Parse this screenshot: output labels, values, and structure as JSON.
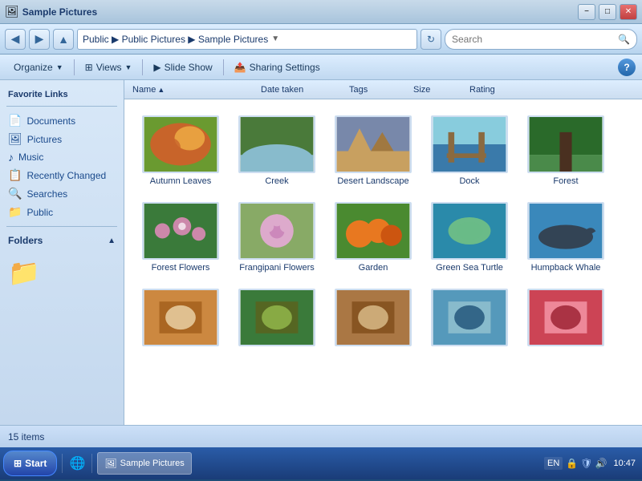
{
  "titlebar": {
    "title": "Sample Pictures",
    "min_btn": "−",
    "max_btn": "□",
    "close_btn": "✕"
  },
  "navbar": {
    "back_icon": "◀",
    "forward_icon": "▶",
    "up_icon": "▲",
    "address": "Public ▶ Public Pictures ▶ Sample Pictures",
    "refresh_icon": "↻",
    "search_placeholder": "Search"
  },
  "toolbar": {
    "organize_label": "Organize",
    "views_label": "Views",
    "slideshow_label": "Slide Show",
    "sharing_label": "Sharing Settings",
    "help_icon": "?"
  },
  "sidebar": {
    "section_title": "Favorite Links",
    "items": [
      {
        "id": "documents",
        "label": "Documents",
        "icon": "📄"
      },
      {
        "id": "pictures",
        "label": "Pictures",
        "icon": "🖼"
      },
      {
        "id": "music",
        "label": "Music",
        "icon": "♪"
      },
      {
        "id": "recently-changed",
        "label": "Recently Changed",
        "icon": "📋"
      },
      {
        "id": "searches",
        "label": "Searches",
        "icon": "🔍"
      },
      {
        "id": "public",
        "label": "Public",
        "icon": "📁"
      }
    ],
    "folders_label": "Folders",
    "folders_arrow": "▲"
  },
  "columns": [
    {
      "id": "name",
      "label": "Name",
      "sort": "▲"
    },
    {
      "id": "date-taken",
      "label": "Date taken"
    },
    {
      "id": "tags",
      "label": "Tags"
    },
    {
      "id": "size",
      "label": "Size"
    },
    {
      "id": "rating",
      "label": "Rating"
    }
  ],
  "files": [
    {
      "id": "autumn-leaves",
      "name": "Autumn Leaves",
      "color1": "#c8642a",
      "color2": "#e8a040",
      "color3": "#6a9a30"
    },
    {
      "id": "creek",
      "name": "Creek",
      "color1": "#4a7a3a",
      "color2": "#6aaa5a",
      "color3": "#88bbcc"
    },
    {
      "id": "desert-landscape",
      "name": "Desert Landscape",
      "color1": "#c8a060",
      "color2": "#a07840",
      "color3": "#7888aa"
    },
    {
      "id": "dock",
      "name": "Dock",
      "color1": "#3a7aaa",
      "color2": "#88ccdd",
      "color3": "#5599cc"
    },
    {
      "id": "forest",
      "name": "Forest",
      "color1": "#2a6a2a",
      "color2": "#4a8a4a",
      "color3": "#88cc88"
    },
    {
      "id": "forest-flowers",
      "name": "Forest Flowers",
      "color1": "#3a7a3a",
      "color2": "#cc88aa",
      "color3": "#5a9a5a"
    },
    {
      "id": "frangipani-flowers",
      "name": "Frangipani Flowers",
      "color1": "#ddaacc",
      "color2": "#cc88bb",
      "color3": "#88aa66"
    },
    {
      "id": "garden",
      "name": "Garden",
      "color1": "#e87820",
      "color2": "#cc5510",
      "color3": "#4a8a30"
    },
    {
      "id": "green-sea-turtle",
      "name": "Green Sea Turtle",
      "color1": "#2a8aaa",
      "color2": "#6abb88",
      "color3": "#44aacc"
    },
    {
      "id": "humpback-whale",
      "name": "Humpback Whale",
      "color1": "#3a88bb",
      "color2": "#5599cc",
      "color3": "#88bbdd"
    },
    {
      "id": "item11",
      "name": "",
      "color1": "#cc8840",
      "color2": "#aa6622",
      "color3": "#e0c090"
    },
    {
      "id": "item12",
      "name": "",
      "color1": "#3a7a3a",
      "color2": "#556622",
      "color3": "#88aa44"
    },
    {
      "id": "item13",
      "name": "",
      "color1": "#aa7744",
      "color2": "#885522",
      "color3": "#ccaa77"
    },
    {
      "id": "item14",
      "name": "",
      "color1": "#5599bb",
      "color2": "#88bbcc",
      "color3": "#336688"
    },
    {
      "id": "item15",
      "name": "",
      "color1": "#cc4455",
      "color2": "#ee8899",
      "color3": "#aa3344"
    }
  ],
  "status": {
    "item_count": "15 items"
  },
  "taskbar": {
    "start_label": "Start",
    "window_label": "Sample Pictures",
    "language": "EN",
    "time": "10:47"
  }
}
